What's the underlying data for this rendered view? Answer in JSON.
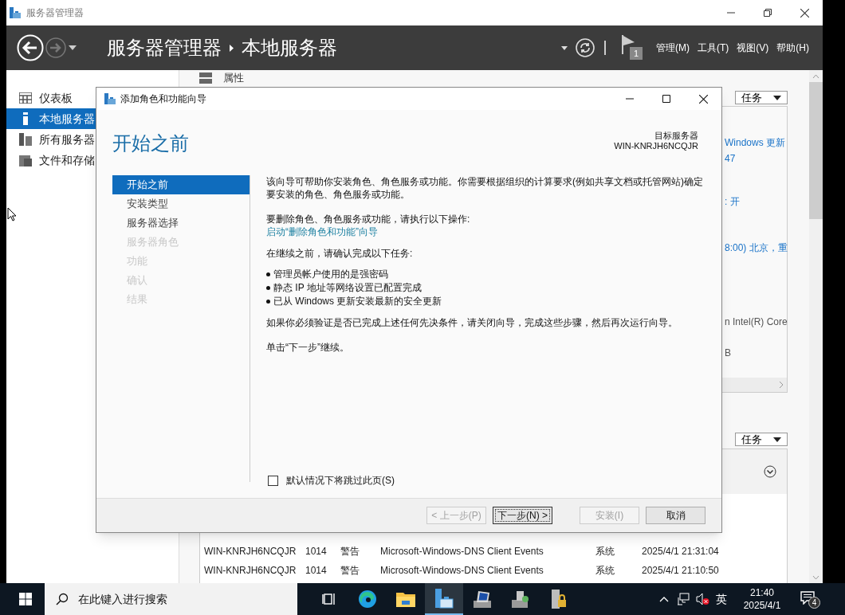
{
  "window": {
    "title": "服务器管理器"
  },
  "header": {
    "breadcrumb": [
      "服务器管理器",
      "本地服务器"
    ],
    "flag_count": "1",
    "menus": [
      "管理(M)",
      "工具(T)",
      "视图(V)",
      "帮助(H)"
    ]
  },
  "sidebar": {
    "items": [
      {
        "label": "仪表板",
        "selected": false
      },
      {
        "label": "本地服务器",
        "selected": true
      },
      {
        "label": "所有服务器",
        "selected": false
      },
      {
        "label": "文件和存储",
        "selected": false
      }
    ]
  },
  "properties": {
    "title": "属性",
    "tasks_label": "任务",
    "values": [
      {
        "text": "Windows 更新",
        "link": true
      },
      {
        "text": "47",
        "link": true
      },
      {
        "text": ": 开",
        "link": true
      },
      {
        "text": "8:00) 北京，重",
        "link": true
      },
      {
        "text": "n Intel(R) Core",
        "link": false
      },
      {
        "text": "B",
        "link": false
      }
    ]
  },
  "events": {
    "tasks_label": "任务",
    "rows": [
      {
        "server": "WIN-KNRJH6NCQJR",
        "id": "1014",
        "severity": "警告",
        "source": "Microsoft-Windows-DNS Client Events",
        "category": "系统",
        "time": "2025/4/1 21:31:04"
      },
      {
        "server": "WIN-KNRJH6NCQJR",
        "id": "1014",
        "severity": "警告",
        "source": "Microsoft-Windows-DNS Client Events",
        "category": "系统",
        "time": "2025/4/1 21:10:50"
      }
    ]
  },
  "dialog": {
    "title": "添加角色和功能向导",
    "heading": "开始之前",
    "target_label": "目标服务器",
    "target_server": "WIN-KNRJH6NCQJR",
    "steps": [
      {
        "label": "开始之前",
        "selected": true,
        "disabled": false
      },
      {
        "label": "安装类型",
        "selected": false,
        "disabled": false
      },
      {
        "label": "服务器选择",
        "selected": false,
        "disabled": false
      },
      {
        "label": "服务器角色",
        "selected": false,
        "disabled": true
      },
      {
        "label": "功能",
        "selected": false,
        "disabled": true
      },
      {
        "label": "确认",
        "selected": false,
        "disabled": true
      },
      {
        "label": "结果",
        "selected": false,
        "disabled": true
      }
    ],
    "intro": "该向导可帮助你安装角色、角色服务或功能。你需要根据组织的计算要求(例如共享文档或托管网站)确定要安装的角色、角色服务或功能。",
    "remove_text": "要删除角色、角色服务或功能，请执行以下操作:",
    "remove_link": "启动“删除角色和功能”向导",
    "tasks_intro": "在继续之前，请确认完成以下任务:",
    "bullets": [
      "管理员帐户使用的是强密码",
      "静态 IP 地址等网络设置已配置完成",
      "已从 Windows 更新安装最新的安全更新"
    ],
    "verify_text": "如果你必须验证是否已完成上述任何先决条件，请关闭向导，完成这些步骤，然后再次运行向导。",
    "continue_text": "单击“下一步”继续。",
    "skip_checkbox": {
      "label": "默认情况下将跳过此页(S)",
      "checked": false
    },
    "buttons": [
      {
        "label": "< 上一步(P)",
        "disabled": true,
        "focused": false
      },
      {
        "label": "下一步(N) >",
        "disabled": false,
        "focused": true
      },
      {
        "label": "安装(I)",
        "disabled": true,
        "focused": false
      },
      {
        "label": "取消",
        "disabled": false,
        "focused": false
      }
    ]
  },
  "taskbar": {
    "search_placeholder": "在此键入进行搜索",
    "apps": [
      {
        "kind": "taskview",
        "selected": false
      },
      {
        "kind": "edge",
        "selected": false
      },
      {
        "kind": "explorer",
        "selected": false
      },
      {
        "kind": "servermanager",
        "selected": true
      },
      {
        "kind": "monitor",
        "selected": false
      },
      {
        "kind": "toolbox",
        "selected": false
      },
      {
        "kind": "lockserver",
        "selected": false
      }
    ],
    "ime": "英",
    "time": "21:40",
    "date": "2025/4/1",
    "notification_count": "4"
  }
}
